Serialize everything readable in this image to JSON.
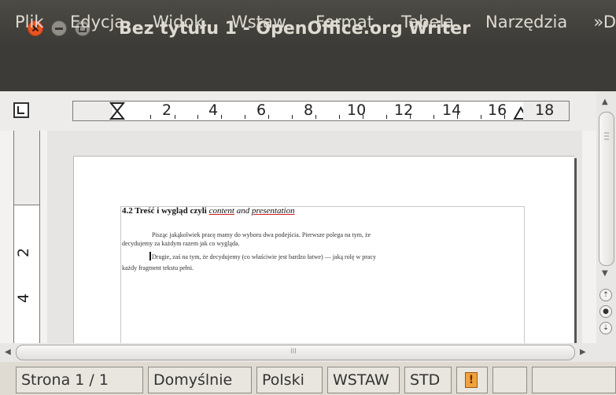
{
  "window": {
    "title": "Bez tytułu 1 - OpenOffice.org Writer",
    "close_symbol": "×"
  },
  "menu": {
    "items": [
      "Plik",
      "Edycja",
      "Widok",
      "Wstaw",
      "Format",
      "Tabela",
      "Narzędzia"
    ],
    "overflow_label": "»D"
  },
  "ruler": {
    "corner_icon": "tab-stop-left-icon",
    "labels": [
      "2",
      "4",
      "6",
      "8",
      "10",
      "12",
      "14",
      "16",
      "18"
    ],
    "vertical_labels": [
      "2",
      "4"
    ]
  },
  "document": {
    "heading_prefix": "4.2 Treść i wygląd czyli ",
    "heading_em1": "content",
    "heading_mid": " and ",
    "heading_em2": "presentation",
    "para1_line1": "Pisząc jakąkolwiek pracę mamy do wyboru dwa podejścia. Pierwsze polega na tym, że",
    "para1_line2": "decydujemy za każdym razem jak co wygląda.",
    "para2_line1": "Drugie, zaś na tym, że decydujemy (co właściwie jest bardzo łatwe) — jaką rolę w pracy",
    "para2_line2": "każdy fragment tekstu pełni."
  },
  "scrollbar": {
    "h_grip": "III"
  },
  "status": {
    "page": "Strona  1 / 1",
    "style": "Domyślnie",
    "language": "Polski",
    "insert_mode": "WSTAW",
    "selection_mode": "STD",
    "modified_symbol": "!"
  },
  "colors": {
    "titlebar": "#3b3a36",
    "close_button": "#e95420",
    "spellcheck": "#d02020"
  }
}
